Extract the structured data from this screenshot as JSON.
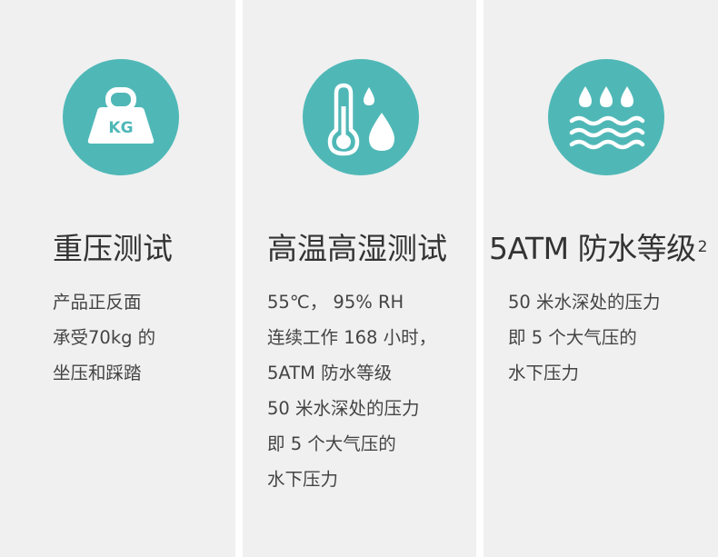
{
  "panels": [
    {
      "icon": "kg-weight-icon",
      "icon_text": "KG",
      "title": "重压测试",
      "lines": [
        "产品正反面",
        "承受70kg 的",
        "坐压和踩踏"
      ]
    },
    {
      "icon": "thermometer-humidity-icon",
      "title": "高温高湿测试",
      "lines": [
        "55℃， 95% RH",
        "连续工作 168 小时，",
        "5ATM 防水等级",
        "50 米水深处的压力",
        "即 5 个大气压的",
        "水下压力"
      ]
    },
    {
      "icon": "water-waves-icon",
      "title": "5ATM 防水等级",
      "title_sup": "2",
      "lines": [
        "50 米水深处的压力",
        "即 5 个大气压的",
        "水下压力"
      ]
    }
  ],
  "colors": {
    "panel_bg": "#f0f0f0",
    "icon_circle": "#4fb8b7",
    "icon_fg": "#ffffff",
    "text": "#333333"
  }
}
